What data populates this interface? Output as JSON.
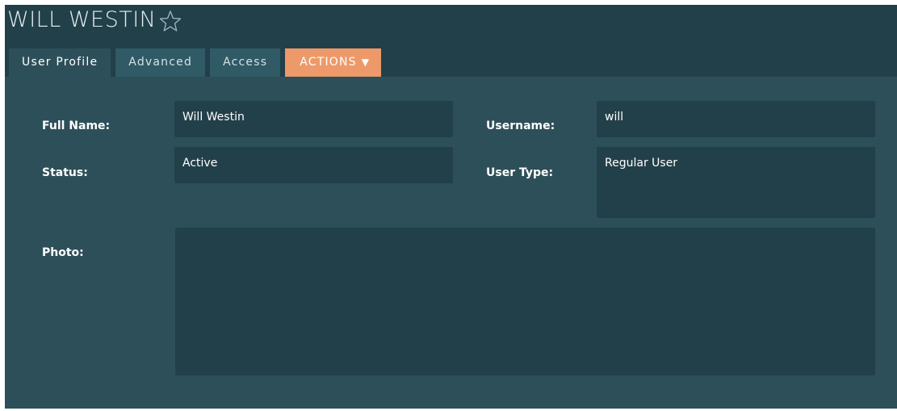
{
  "record": {
    "title": "WILL WESTIN",
    "favorite_icon": "star-outline-icon"
  },
  "tabs": [
    {
      "label": "User Profile",
      "active": true
    },
    {
      "label": "Advanced",
      "active": false
    },
    {
      "label": "Access",
      "active": false
    },
    {
      "label": "ACTIONS",
      "active": false,
      "icon": "caret-down-icon"
    }
  ],
  "fields": {
    "full_name": {
      "label": "Full Name:",
      "value": "Will Westin"
    },
    "username": {
      "label": "Username:",
      "value": "will"
    },
    "status": {
      "label": "Status:",
      "value": "Active"
    },
    "user_type": {
      "label": "User Type:",
      "value": "Regular User"
    },
    "photo": {
      "label": "Photo:",
      "value": ""
    }
  },
  "colors": {
    "background": "#22404a",
    "panel": "#2d4f59",
    "tab": "#2f5a66",
    "actions_tab": "#ee9969",
    "field": "#22404a",
    "text": "#ffffff"
  }
}
